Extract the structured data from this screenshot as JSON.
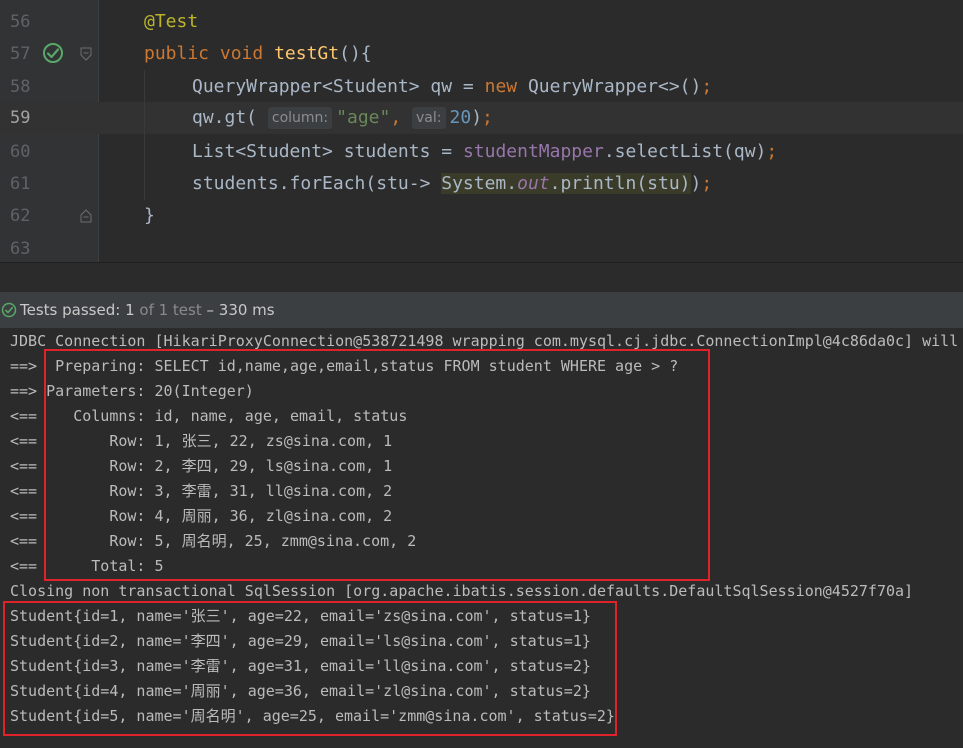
{
  "editor": {
    "lines": [
      {
        "num": "56"
      },
      {
        "num": "57"
      },
      {
        "num": "58"
      },
      {
        "num": "59"
      },
      {
        "num": "60"
      },
      {
        "num": "61"
      },
      {
        "num": "62"
      },
      {
        "num": "63"
      }
    ],
    "tokens": {
      "annotation": "@Test",
      "kw_public": "public",
      "kw_void": "void",
      "method_name": "testGt",
      "method_paren": "(){",
      "qw_type": "QueryWrapper<Student> qw = ",
      "kw_new": "new",
      "qw_ctor": " QueryWrapper<>()",
      "semi": ";",
      "gt_call": "qw.gt(",
      "hint_column": "column:",
      "str_age": "\"age\"",
      "comma": ",",
      "hint_val": "val:",
      "num_20": "20",
      "close_paren": ")",
      "list_decl": "List<Student> students = ",
      "mapper_field": "studentMapper",
      "select_call": ".selectList(qw)",
      "foreach_call": "students.forEach(stu-> ",
      "system": "System.",
      "out": "out",
      "println": ".println(stu)",
      "close_paren2": ")",
      "close_brace": "}"
    }
  },
  "tests": {
    "passed_label": "Tests passed:",
    "count": "1",
    "of_label": "of 1 test",
    "duration": "– 330 ms"
  },
  "console": {
    "lines": [
      "JDBC Connection [HikariProxyConnection@538721498 wrapping com.mysql.cj.jdbc.ConnectionImpl@4c86da0c] will",
      "==>  Preparing: SELECT id,name,age,email,status FROM student WHERE age > ?",
      "==> Parameters: 20(Integer)",
      "<==    Columns: id, name, age, email, status",
      "<==        Row: 1, 张三, 22, zs@sina.com, 1",
      "<==        Row: 2, 李四, 29, ls@sina.com, 1",
      "<==        Row: 3, 李雷, 31, ll@sina.com, 2",
      "<==        Row: 4, 周丽, 36, zl@sina.com, 2",
      "<==        Row: 5, 周名明, 25, zmm@sina.com, 2",
      "<==      Total: 5",
      "Closing non transactional SqlSession [org.apache.ibatis.session.defaults.DefaultSqlSession@4527f70a]",
      "Student{id=1, name='张三', age=22, email='zs@sina.com', status=1}",
      "Student{id=2, name='李四', age=29, email='ls@sina.com', status=1}",
      "Student{id=3, name='李雷', age=31, email='ll@sina.com', status=2}",
      "Student{id=4, name='周丽', age=36, email='zl@sina.com', status=2}",
      "Student{id=5, name='周名明', age=25, email='zmm@sina.com', status=2}"
    ]
  },
  "colors": {
    "highlight_box": "#e0232b",
    "keyword": "#cc7832",
    "method": "#ffc66d",
    "string": "#6a8759",
    "number": "#6897bb",
    "field": "#9876aa",
    "pass_icon": "#59a869"
  },
  "icons": {
    "run": "run-test-passed-icon",
    "fold": "fold-icon",
    "tests_passed": "check-circle-icon"
  }
}
